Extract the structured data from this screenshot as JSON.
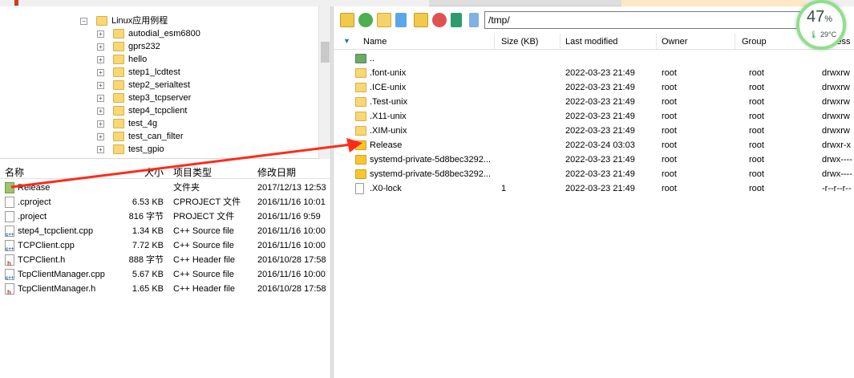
{
  "window": {
    "path": "/tmp/"
  },
  "gauge": {
    "percent": "47",
    "percent_sign": "%",
    "temp": "29°C",
    "accent": "#8ee08a"
  },
  "left_tree": [
    {
      "label": "Linux应用例程",
      "level": 0
    },
    {
      "label": "autodial_esm6800",
      "level": 1
    },
    {
      "label": "gprs232",
      "level": 1
    },
    {
      "label": "hello",
      "level": 1
    },
    {
      "label": "step1_lcdtest",
      "level": 1
    },
    {
      "label": "step2_serialtest",
      "level": 1
    },
    {
      "label": "step3_tcpserver",
      "level": 1
    },
    {
      "label": "step4_tcpclient",
      "level": 1
    },
    {
      "label": "test_4g",
      "level": 1
    },
    {
      "label": "test_can_filter",
      "level": 1
    },
    {
      "label": "test_gpio",
      "level": 1
    }
  ],
  "left_headers": {
    "name": "名称",
    "size": "大小",
    "type": "项目类型",
    "modified": "修改日期"
  },
  "left_files": [
    {
      "name": "Release",
      "size": "",
      "type": "文件夹",
      "modified": "2017/12/13 12:53",
      "icon": "folder-green"
    },
    {
      "name": ".cproject",
      "size": "6.53 KB",
      "type": "CPROJECT 文件",
      "modified": "2016/11/16 10:01",
      "icon": "file"
    },
    {
      "name": ".project",
      "size": "816 字节",
      "type": "PROJECT 文件",
      "modified": "2016/11/16 9:59",
      "icon": "file"
    },
    {
      "name": "step4_tcpclient.cpp",
      "size": "1.34 KB",
      "type": "C++ Source file",
      "modified": "2016/11/16 10:00",
      "icon": "cpp"
    },
    {
      "name": "TCPClient.cpp",
      "size": "7.72 KB",
      "type": "C++ Source file",
      "modified": "2016/11/16 10:00",
      "icon": "cpp"
    },
    {
      "name": "TCPClient.h",
      "size": "888 字节",
      "type": "C++ Header file",
      "modified": "2016/10/28 17:58",
      "icon": "h"
    },
    {
      "name": "TcpClientManager.cpp",
      "size": "5.67 KB",
      "type": "C++ Source file",
      "modified": "2016/11/16 10:00",
      "icon": "cpp"
    },
    {
      "name": "TcpClientManager.h",
      "size": "1.65 KB",
      "type": "C++ Header file",
      "modified": "2016/10/28 17:58",
      "icon": "h"
    }
  ],
  "right_headers": {
    "name": "Name",
    "size": "Size (KB)",
    "modified": "Last modified",
    "owner": "Owner",
    "group": "Group",
    "access": "Access"
  },
  "right_files": [
    {
      "name": "..",
      "size": "",
      "modified": "",
      "owner": "",
      "group": "",
      "access": "",
      "icon": "up"
    },
    {
      "name": ".font-unix",
      "size": "",
      "modified": "2022-03-23 21:49",
      "owner": "root",
      "group": "root",
      "access": "drwxrw",
      "icon": "folder"
    },
    {
      "name": ".ICE-unix",
      "size": "",
      "modified": "2022-03-23 21:49",
      "owner": "root",
      "group": "root",
      "access": "drwxrw",
      "icon": "folder"
    },
    {
      "name": ".Test-unix",
      "size": "",
      "modified": "2022-03-23 21:49",
      "owner": "root",
      "group": "root",
      "access": "drwxrw",
      "icon": "folder"
    },
    {
      "name": ".X11-unix",
      "size": "",
      "modified": "2022-03-23 21:49",
      "owner": "root",
      "group": "root",
      "access": "drwxrw",
      "icon": "folder"
    },
    {
      "name": ".XIM-unix",
      "size": "",
      "modified": "2022-03-23 21:49",
      "owner": "root",
      "group": "root",
      "access": "drwxrw",
      "icon": "folder"
    },
    {
      "name": "Release",
      "size": "",
      "modified": "2022-03-24 03:03",
      "owner": "root",
      "group": "root",
      "access": "drwxr-x",
      "icon": "folder-yellow"
    },
    {
      "name": "systemd-private-5d8bec3292...",
      "size": "",
      "modified": "2022-03-23 21:49",
      "owner": "root",
      "group": "root",
      "access": "drwx----",
      "icon": "folder-yellow"
    },
    {
      "name": "systemd-private-5d8bec3292...",
      "size": "",
      "modified": "2022-03-23 21:49",
      "owner": "root",
      "group": "root",
      "access": "drwx----",
      "icon": "folder-yellow"
    },
    {
      "name": ".X0-lock",
      "size": "1",
      "modified": "2022-03-23 21:49",
      "owner": "root",
      "group": "root",
      "access": "-r--r--r--",
      "icon": "file"
    }
  ],
  "annotation": {
    "color": "#ff2a1a"
  }
}
